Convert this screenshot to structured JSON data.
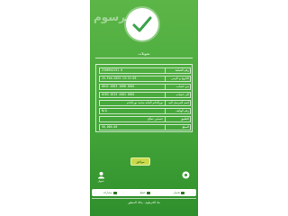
{
  "header": {
    "watermark": "مرسوم",
    "success_icon": "checkmark-icon"
  },
  "page_title": "تحويلات",
  "details": [
    {
      "label": "رقم العملية",
      "value": "2308942151 0",
      "rtl": false
    },
    {
      "label": "التاريخ و الزمن",
      "value": "15-Feb-2025 13:21:05",
      "rtl": false
    },
    {
      "label": "من حساب",
      "value": "8032 0303 1608 0001",
      "rtl": false
    },
    {
      "label": "الى حساب",
      "value": "0283 0215 4401 0001",
      "rtl": false
    },
    {
      "label": "اسم المرسل اليه",
      "value": "نورالدائم العابد محمد نورالدائم",
      "rtl": true
    },
    {
      "label": "رقم الهاتف",
      "value": "N/A",
      "rtl": false
    },
    {
      "label": "التعليق",
      "value": "حسابي صالح",
      "rtl": true
    },
    {
      "label": "المبلغ",
      "value": "50,000.00",
      "rtl": false
    }
  ],
  "buttons": {
    "ok": "موافق"
  },
  "side": {
    "left_label": "تحويل",
    "right_label": ""
  },
  "bottom_tabs": [
    {
      "label": "مشاركة"
    },
    {
      "label": "حفظ"
    },
    {
      "label": "تحميل"
    }
  ],
  "footer": "بنك الخرطوم - بنكك المتطور"
}
